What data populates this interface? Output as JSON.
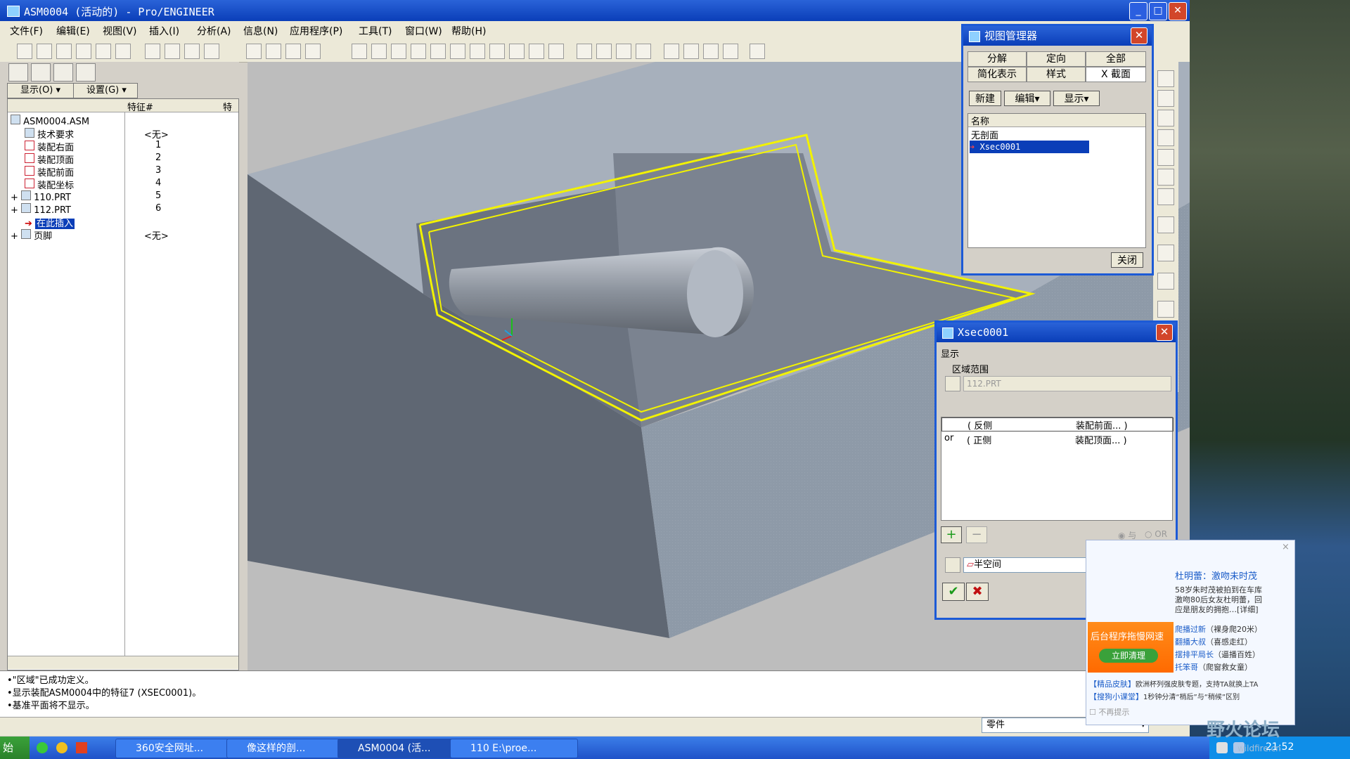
{
  "window": {
    "title": "ASM0004 (活动的) - Pro/ENGINEER"
  },
  "menubar": [
    "文件(F)",
    "编辑(E)",
    "视图(V)",
    "插入(I)",
    "分析(A)",
    "信息(N)",
    "应用程序(P)",
    "工具(T)",
    "窗口(W)",
    "帮助(H)"
  ],
  "left_panel": {
    "show_button": "显示(O)",
    "settings_button": "设置(G)",
    "column_feature_num": "特征#",
    "column_feature": "特"
  },
  "tree": [
    {
      "label": "ASM0004.ASM",
      "num": ""
    },
    {
      "label": "技术要求",
      "num": "<无>"
    },
    {
      "label": "装配右面",
      "num": "1"
    },
    {
      "label": "装配顶面",
      "num": "2"
    },
    {
      "label": "装配前面",
      "num": "3"
    },
    {
      "label": "装配坐标",
      "num": "4"
    },
    {
      "label": "110.PRT",
      "num": "5"
    },
    {
      "label": "112.PRT",
      "num": "6"
    },
    {
      "label": "在此插入",
      "num": ""
    },
    {
      "label": "页脚",
      "num": "<无>"
    }
  ],
  "messages": [
    "•\"区域\"已成功定义。",
    "•显示装配ASM0004中的特征7 (XSEC0001)。",
    "•基准平面将不显示。"
  ],
  "status": {
    "filter_value": "零件"
  },
  "view_manager": {
    "title": "视图管理器",
    "tabs_row1": [
      "分解",
      "定向",
      "全部"
    ],
    "tabs_row2": [
      "简化表示",
      "样式",
      "X 截面"
    ],
    "new_button": "新建",
    "edit_button": "编辑",
    "display_button": "显示",
    "list_header": "名称",
    "items": [
      "无剖面",
      "Xsec0001"
    ],
    "close_button": "关闭"
  },
  "xsec": {
    "title": "Xsec0001",
    "display_label": "显示",
    "region_label": "区域范围",
    "part_value": "112.PRT",
    "rows": [
      {
        "prefix": "",
        "side": "( 反侧",
        "ref": "装配前面... )"
      },
      {
        "prefix": "or",
        "side": "( 正侧",
        "ref": "装配顶面... )"
      }
    ],
    "and_label": "与",
    "or_label": "OR",
    "type_value": "半空间"
  },
  "ad": {
    "headline": "杜明蕾：激吻未时茂",
    "desc1": "58岁朱时茂被拍到在车库",
    "desc2": "激吻80后女友杜明蕾，回",
    "desc3": "应是朋友的拥抱…[详细]",
    "banner1": "后台程序拖慢网速",
    "banner2": "立即清理",
    "links": [
      {
        "t": "爬播过新",
        "d": "（裸身爬20米）"
      },
      {
        "t": "翻播大叔",
        "d": "（喜感走红）"
      },
      {
        "t": "摆排平局长",
        "d": "（逼播百姓）"
      },
      {
        "t": "托笨哥",
        "d": "（爬窗救女童）"
      }
    ],
    "bottom1_link": "【精品皮肤】",
    "bottom1_text": "欧洲杯列强皮肤专题，支持TA就换上TA",
    "bottom2_link": "【搜狗小课堂】",
    "bottom2_text": "1秒钟分清“梢后”与“稍候”区别",
    "no_remind": "不再提示"
  },
  "taskbar": {
    "start": "始",
    "tasks": [
      "360安全网址...",
      "像这样的剖...",
      "ASM0004 (活...",
      "110 E:\\proe..."
    ],
    "clock": "21:52"
  },
  "watermark": {
    "text": "野火论坛",
    "url": "wildfire.cn"
  },
  "colors": {
    "accent": "#0a3eb8",
    "section_outline": "#f2f200",
    "model_face": "#8e9aa8"
  }
}
